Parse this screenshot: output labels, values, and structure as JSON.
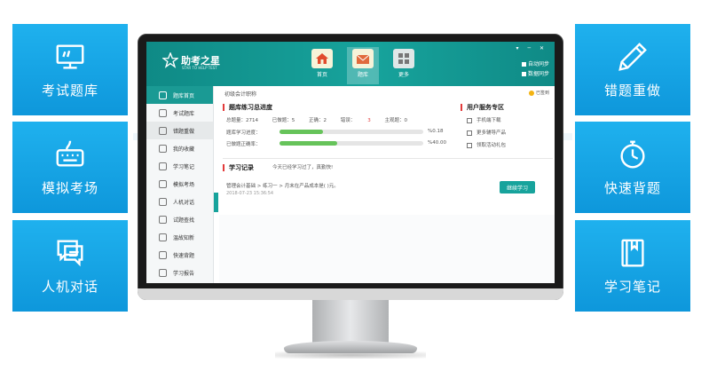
{
  "feature_tiles": [
    {
      "label": "考试题库",
      "icon": "monitor-icon"
    },
    {
      "label": "模拟考场",
      "icon": "keyboard-icon"
    },
    {
      "label": "人机对话",
      "icon": "chat-bubble-icon"
    },
    {
      "label": "错题重做",
      "icon": "pencil-icon"
    },
    {
      "label": "快速背题",
      "icon": "stopwatch-icon"
    },
    {
      "label": "学习笔记",
      "icon": "notebook-icon"
    }
  ],
  "app": {
    "logo_text": "助考之星",
    "logo_sub": "STAR TO HELP TEST",
    "nav": [
      {
        "label": "首页",
        "icon": "house-icon",
        "active": false
      },
      {
        "label": "题库",
        "icon": "envelope-icon",
        "active": true
      },
      {
        "label": "更多",
        "icon": "grid-icon",
        "active": false
      }
    ],
    "header_options": [
      "自动同步",
      "数据同步"
    ],
    "window_controls": "▾ ─ ✕"
  },
  "sidebar": {
    "items": [
      {
        "label": "题库首页",
        "state": "active"
      },
      {
        "label": "考试题库",
        "state": ""
      },
      {
        "label": "错题重做",
        "state": "sel"
      },
      {
        "label": "我的收藏",
        "state": ""
      },
      {
        "label": "学习笔记",
        "state": ""
      },
      {
        "label": "模拟考场",
        "state": ""
      },
      {
        "label": "人机对话",
        "state": ""
      },
      {
        "label": "试题查找",
        "state": ""
      },
      {
        "label": "温故知新",
        "state": ""
      },
      {
        "label": "快速背题",
        "state": ""
      },
      {
        "label": "学习报告",
        "state": ""
      }
    ]
  },
  "main": {
    "breadcrumb": "初级会计职称",
    "signin_label": "已签到",
    "progress_section": {
      "title": "题库练习总进度",
      "total": "总题量：2714",
      "done": "已做题：5",
      "correct": "正确：2",
      "wrong_label": "错误：",
      "wrong_value": "3",
      "subjective": "主观题：0",
      "progress_label": "题库学习进度：",
      "progress_value": "%0.18",
      "progress_fraction": 0.0018,
      "accuracy_label": "已做题正确率：",
      "accuracy_value": "%40.00",
      "accuracy_fraction": 0.4
    },
    "service_section": {
      "title": "用户服务专区",
      "items": [
        "手机端下载",
        "更多辅导产品",
        "领取活动礼包"
      ]
    },
    "record_section": {
      "title": "学习记录",
      "slogan": "今天已经学习过了，真勤快!",
      "path": "管理会计基础 > 练习一 > 月末在产品成本是(    )元。",
      "time": "2018-07-23 15:36:54",
      "continue_label": "继续学习"
    }
  },
  "colors": {
    "tile_blue": "#1fb1ee",
    "app_teal": "#17a39c",
    "error_red": "#e23b3b",
    "progress_green": "#66c35a"
  }
}
